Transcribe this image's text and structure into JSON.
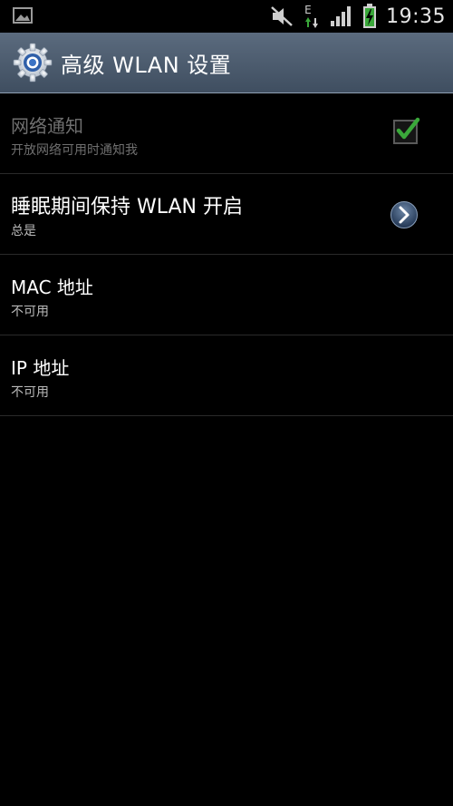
{
  "status_bar": {
    "time": "19:35",
    "network_type": "E",
    "icons": [
      "gallery-icon",
      "mute-icon",
      "data-arrows-icon",
      "signal-icon",
      "battery-charging-icon"
    ]
  },
  "action_bar": {
    "title": "高级 WLAN 设置",
    "icon": "settings-gear-icon"
  },
  "settings": [
    {
      "title": "网络通知",
      "subtitle": "开放网络可用时通知我",
      "control": "checkbox",
      "checked": true,
      "enabled": false
    },
    {
      "title": "睡眠期间保持 WLAN 开启",
      "subtitle": "总是",
      "control": "chevron",
      "enabled": true
    },
    {
      "title": "MAC 地址",
      "subtitle": "不可用",
      "control": "none",
      "enabled": true
    },
    {
      "title": "IP 地址",
      "subtitle": "不可用",
      "control": "none",
      "enabled": true
    }
  ],
  "colors": {
    "background": "#000000",
    "action_bar_top": "#5b6b7e",
    "action_bar_bottom": "#3f4e60",
    "check_green": "#3aa83a",
    "divider": "#2a2a2a"
  }
}
